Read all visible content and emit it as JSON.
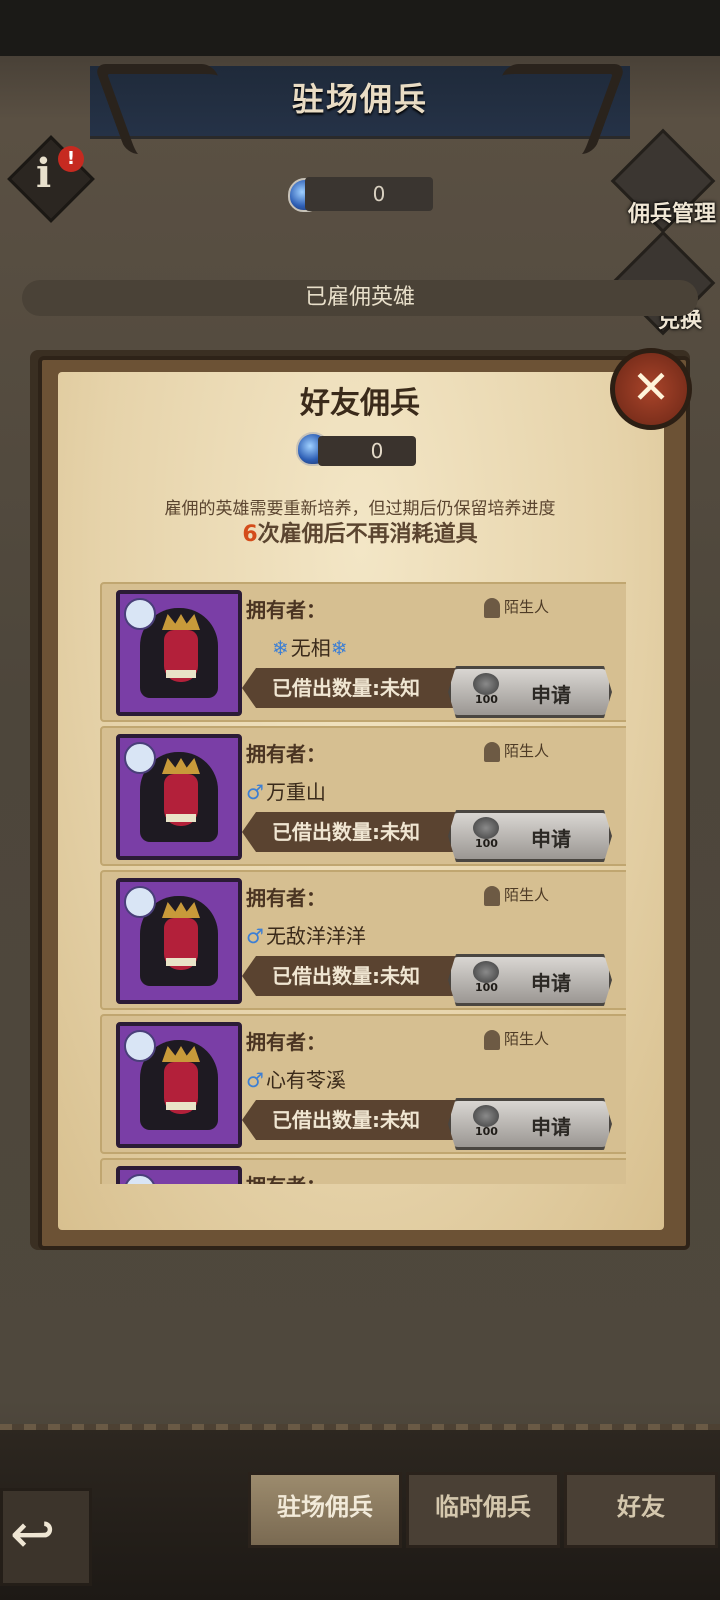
{
  "header": {
    "title": "驻场佣兵"
  },
  "info": {
    "badge": "!"
  },
  "top_currency": {
    "value": "0"
  },
  "side": {
    "manage_label": "佣兵管理",
    "exchange_label": "兑换"
  },
  "hired_bar": {
    "label": "已雇佣英雄"
  },
  "modal": {
    "title": "好友佣兵",
    "currency_value": "0",
    "close_label": "✕",
    "desc_line1": "雇佣的英雄需要重新培养，但过期后仍保留培养进度",
    "desc_line2_num": "6",
    "desc_line2_text": "次雇佣后不再消耗道具",
    "cards": [
      {
        "owner_label": "拥有者：",
        "relation": "陌生人",
        "name_prefix": "❄",
        "name": "无相",
        "name_suffix": "❄",
        "lend_text": "已借出数量:未知",
        "cost": "100",
        "apply_label": "申请"
      },
      {
        "owner_label": "拥有者：",
        "relation": "陌生人",
        "name_prefix": "♂",
        "name": "万重山",
        "name_suffix": "",
        "lend_text": "已借出数量:未知",
        "cost": "100",
        "apply_label": "申请"
      },
      {
        "owner_label": "拥有者：",
        "relation": "陌生人",
        "name_prefix": "♂",
        "name": "无敌洋洋洋",
        "name_suffix": "",
        "lend_text": "已借出数量:未知",
        "cost": "100",
        "apply_label": "申请"
      },
      {
        "owner_label": "拥有者：",
        "relation": "陌生人",
        "name_prefix": "♂",
        "name": "心有苓溪",
        "name_suffix": "",
        "lend_text": "已借出数量:未知",
        "cost": "100",
        "apply_label": "申请"
      },
      {
        "owner_label": "拥有者：",
        "relation": "",
        "name_prefix": "",
        "name": "",
        "name_suffix": "",
        "lend_text": "",
        "cost": "",
        "apply_label": ""
      }
    ]
  },
  "tabs": [
    {
      "label": "驻场佣兵",
      "active": true
    },
    {
      "label": "临时佣兵",
      "active": false
    },
    {
      "label": "好友",
      "active": false
    }
  ],
  "back": {
    "icon": "back-arrow-icon"
  }
}
